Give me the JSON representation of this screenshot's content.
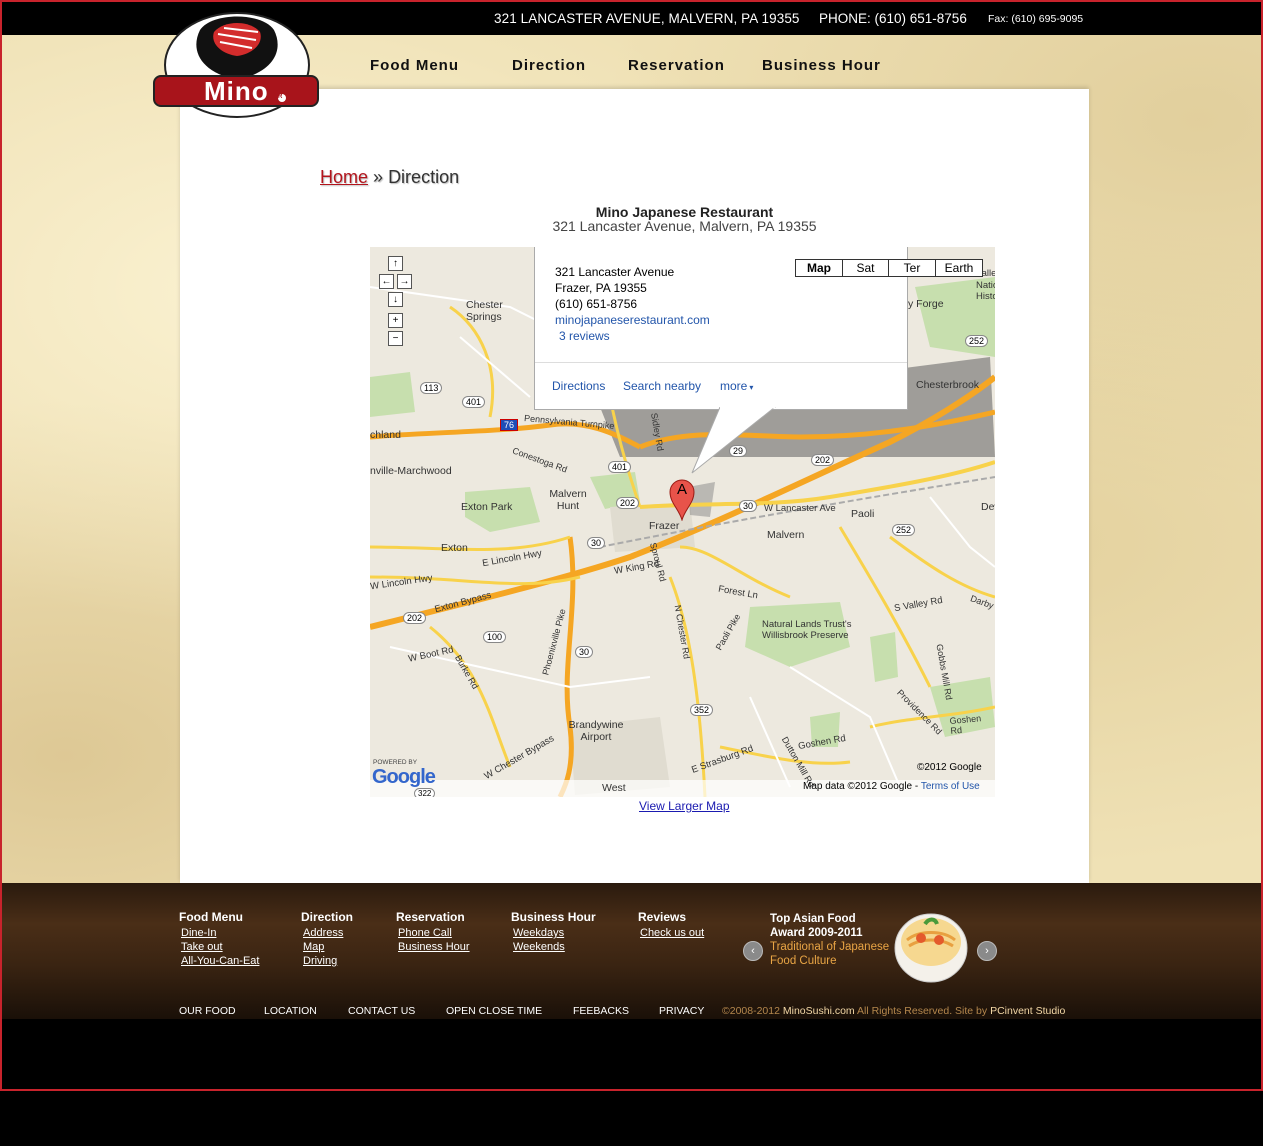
{
  "topbar": {
    "address": "321 LANCASTER AVENUE, MALVERN, PA 19355",
    "phone": "PHONE: (610) 651-8756",
    "fax": "Fax: (610) 695-9095"
  },
  "logo": {
    "text": "Mino",
    "mark": "R"
  },
  "nav": [
    "Food Menu",
    "Direction",
    "Reservation",
    "Business Hour"
  ],
  "breadcrumb": {
    "home": "Home",
    "separator": "»",
    "current": "Direction"
  },
  "restaurant": {
    "name": "Mino Japanese Restaurant",
    "address": "321 Lancaster Avenue, Malvern, PA 19355"
  },
  "map": {
    "types": [
      "Map",
      "Sat",
      "Ter",
      "Earth"
    ],
    "selected_type": "Map",
    "infowindow": {
      "street": "321 Lancaster Avenue",
      "city": "Frazer, PA 19355",
      "phone": "(610) 651-8756",
      "website": "minojapaneserestaurant.com",
      "reviews": "3 reviews",
      "actions": [
        "Directions",
        "Search nearby",
        "more"
      ]
    },
    "marker_label": "A",
    "powered_by": "POWERED BY",
    "google_logo": "Google",
    "copyright": "©2012 Google",
    "attribution": "Map data ©2012 Google",
    "terms": "Terms of Use",
    "labels": {
      "chester_springs": "Chester Springs",
      "chesterbrook": "Chesterbrook",
      "valley_forge": "y Forge",
      "national_historic": "Natic Histo",
      "valle": "Valle",
      "chland": "chland",
      "marchwood": "nville-Marchwood",
      "malvern_hunt": "Malvern Hunt",
      "exton_park": "Exton Park",
      "frazer": "Frazer",
      "malvern": "Malvern",
      "paoli": "Paoli",
      "exton": "Exton",
      "lincoln_hwy": "E Lincoln Hwy",
      "w_lincoln_hwy": "W Lincoln Hwy",
      "exton_bypass": "Exton Bypass",
      "w_king_rd": "W King Rd",
      "forest_ln": "Forest Ln",
      "w_lancaster": "W Lancaster Ave",
      "natural_lands": "Natural Lands Trust's Willisbrook Preserve",
      "s_valley_rd": "S Valley Rd",
      "w_boot_rd": "W Boot Rd",
      "brandywine": "Brandywine Airport",
      "w_chester_bypass": "W Chester Bypass",
      "goshen_rd": "Goshen Rd",
      "e_strasburg": "E Strasburg Rd",
      "west": "West",
      "pa_turnpike": "Pennsylvania Turnpike",
      "conestoga": "Conestoga Rd",
      "sproul": "Sproul Rd",
      "phoenixville_pike": "Phoenixville Pike",
      "n_chester_rd": "N Chester Rd",
      "paoli_pike": "Paoli Pike",
      "providence_rd": "Providence Rd",
      "gobbs_mill": "Gobbs Mill Rd",
      "goshen_rd2": "Goshen Rd",
      "darby": "Darby",
      "sidley": "Sidley Rd",
      "burke_rd": "Burke Rd",
      "dutton_mill": "Dutton Mill Rd",
      "dev": "Dev"
    },
    "shields": [
      "113",
      "401",
      "76",
      "401",
      "202",
      "30",
      "30",
      "202",
      "29",
      "252",
      "252",
      "202",
      "100",
      "30",
      "202",
      "352",
      "322"
    ],
    "larger_map": "View Larger Map"
  },
  "footer": {
    "columns": [
      {
        "heading": "Food Menu",
        "links": [
          "Dine-In",
          "Take out",
          "All-You-Can-Eat"
        ]
      },
      {
        "heading": "Direction",
        "links": [
          "Address",
          "Map",
          "Driving"
        ]
      },
      {
        "heading": "Reservation",
        "links": [
          "Phone Call",
          "Business Hour"
        ]
      },
      {
        "heading": "Business Hour",
        "links": [
          "Weekdays",
          "Weekends"
        ]
      },
      {
        "heading": "Reviews",
        "links": [
          "Check us out"
        ]
      }
    ],
    "award": {
      "line1": "Top Asian Food",
      "line2": "Award 2009-2011",
      "line3": "Traditional of Japanese",
      "line4": "Food Culture"
    },
    "bottom_links": [
      "OUR FOOD",
      "LOCATION",
      "CONTACT US",
      "OPEN CLOSE TIME",
      "FEEBACKS",
      "PRIVACY"
    ],
    "copyright_pre": "©2008-2012",
    "copyright_site": "MinoSushi.com",
    "copyright_mid": "All Rights Reserved. Site by",
    "copyright_studio": "PCinvent Studio"
  }
}
